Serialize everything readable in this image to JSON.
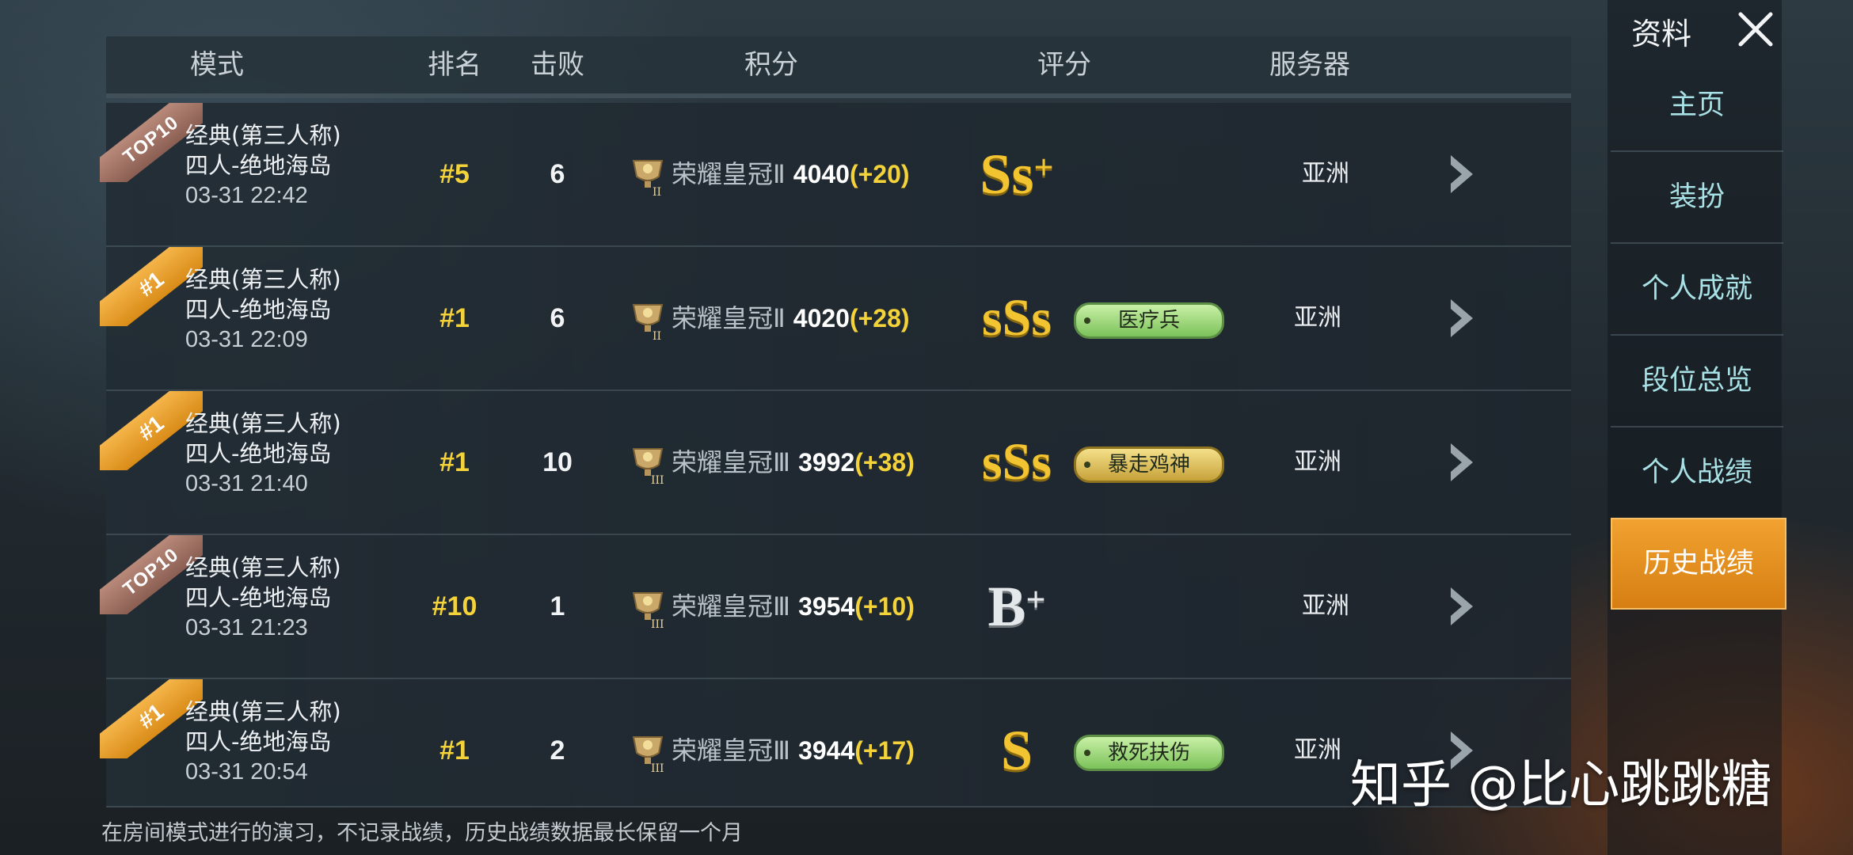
{
  "header": {
    "mode": "模式",
    "rank": "排名",
    "kills": "击败",
    "score": "积分",
    "grade": "评分",
    "server": "服务器"
  },
  "rows": [
    {
      "ribbon": "TOP10",
      "mode_line1": "经典(第三人称)",
      "mode_line2": "四人-绝地海岛",
      "time": "03-31 22:42",
      "rank": "#5",
      "kills": "6",
      "tier": "荣耀皇冠Ⅱ",
      "points": "4040",
      "delta": "(+20)",
      "grade": "Ss",
      "grade_plus": "+",
      "badge": "",
      "server": "亚洲"
    },
    {
      "ribbon": "#1",
      "mode_line1": "经典(第三人称)",
      "mode_line2": "四人-绝地海岛",
      "time": "03-31 22:09",
      "rank": "#1",
      "kills": "6",
      "tier": "荣耀皇冠Ⅱ",
      "points": "4020",
      "delta": "(+28)",
      "grade": "sSs",
      "grade_plus": "",
      "badge": "医疗兵",
      "server": "亚洲"
    },
    {
      "ribbon": "#1",
      "mode_line1": "经典(第三人称)",
      "mode_line2": "四人-绝地海岛",
      "time": "03-31 21:40",
      "rank": "#1",
      "kills": "10",
      "tier": "荣耀皇冠Ⅲ",
      "points": "3992",
      "delta": "(+38)",
      "grade": "sSs",
      "grade_plus": "",
      "badge": "暴走鸡神",
      "server": "亚洲"
    },
    {
      "ribbon": "TOP10",
      "mode_line1": "经典(第三人称)",
      "mode_line2": "四人-绝地海岛",
      "time": "03-31 21:23",
      "rank": "#10",
      "kills": "1",
      "tier": "荣耀皇冠Ⅲ",
      "points": "3954",
      "delta": "(+10)",
      "grade": "B",
      "grade_plus": "+",
      "badge": "",
      "server": "亚洲"
    },
    {
      "ribbon": "#1",
      "mode_line1": "经典(第三人称)",
      "mode_line2": "四人-绝地海岛",
      "time": "03-31 20:54",
      "rank": "#1",
      "kills": "2",
      "tier": "荣耀皇冠Ⅲ",
      "points": "3944",
      "delta": "(+17)",
      "grade": "S",
      "grade_plus": "",
      "badge": "救死扶伤",
      "server": "亚洲"
    }
  ],
  "footer_note": "在房间模式进行的演习，不记录战绩，历史战绩数据最长保留一个月",
  "sidebar": {
    "title": "资料",
    "items": [
      {
        "label": "主页"
      },
      {
        "label": "装扮"
      },
      {
        "label": "个人成就"
      },
      {
        "label": "段位总览"
      },
      {
        "label": "个人战绩"
      },
      {
        "label": "历史战绩"
      }
    ],
    "active": "历史战绩"
  },
  "watermark": "知乎 @比心跳跳糖",
  "colors": {
    "accent": "#e8921f",
    "rank": "#f3d23a",
    "sidebar_text": "#a9e2e6",
    "badge_green": "#8ccf6a",
    "badge_gold": "#d8b548"
  }
}
